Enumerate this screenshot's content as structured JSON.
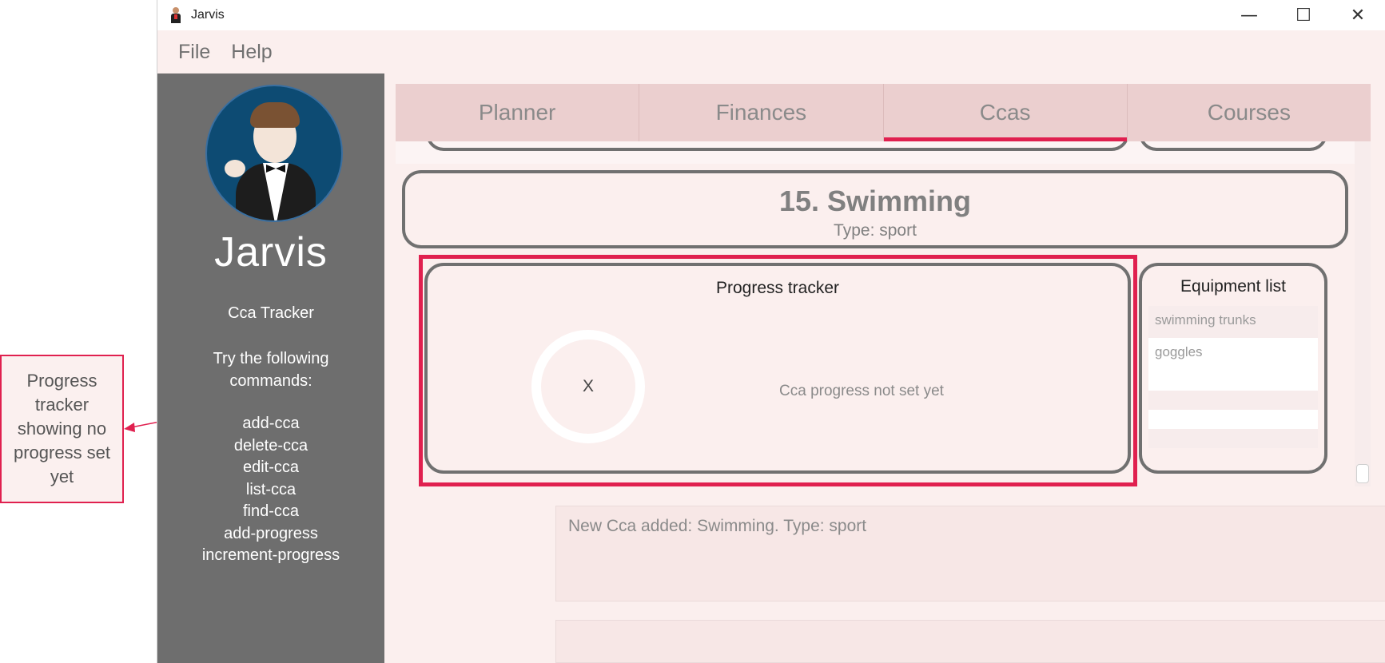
{
  "window": {
    "title": "Jarvis",
    "controls": {
      "minimize": "—",
      "maximize": "☐",
      "close": "✕"
    }
  },
  "menu": {
    "items": [
      "File",
      "Help"
    ]
  },
  "sidebar": {
    "brand": "Jarvis",
    "tracker_title": "Cca Tracker",
    "try_text": "Try the following commands:",
    "commands": [
      "add-cca",
      "delete-cca",
      "edit-cca",
      "list-cca",
      "find-cca",
      "add-progress",
      "increment-progress"
    ]
  },
  "tabs": {
    "items": [
      "Planner",
      "Finances",
      "Ccas",
      "Courses"
    ],
    "active": "Ccas"
  },
  "cca": {
    "name": "15.  Swimming",
    "type": "Type: sport"
  },
  "progress": {
    "title": "Progress tracker",
    "ring_label": "X",
    "message": "Cca progress not set yet"
  },
  "equipment": {
    "title": "Equipment list",
    "items": [
      "swimming trunks",
      "goggles"
    ]
  },
  "result": {
    "text": "New Cca added: Swimming. Type: sport"
  },
  "annotation": {
    "text": "Progress tracker showing no progress set yet",
    "color": "#e0204f"
  },
  "colors": {
    "accent": "#e0204f",
    "sidebar": "#6e6e6e",
    "background": "#fbefee",
    "tab_bar": "#ebcfcf"
  }
}
